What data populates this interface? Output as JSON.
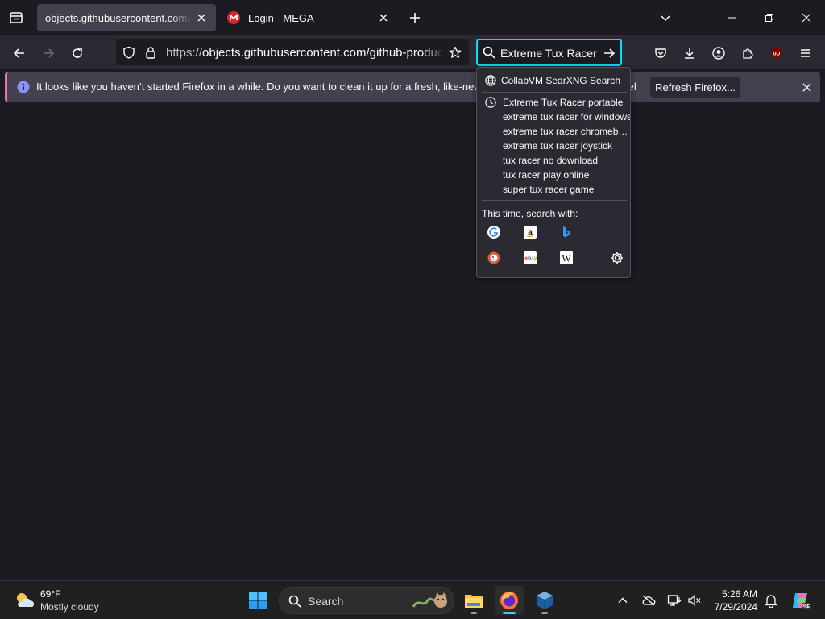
{
  "tabs": [
    {
      "title": "objects.githubusercontent.com/github-production-release-asset",
      "active": true
    },
    {
      "title": "Login - MEGA",
      "active": false
    }
  ],
  "address_bar": {
    "protocol": "https://",
    "url": "objects.githubusercontent.com/github-production-release-asset"
  },
  "search_bar": {
    "value": "Extreme Tux Racer portable"
  },
  "notification": {
    "message": "It looks like you haven’t started Firefox in a while. Do you want to clean it up for a fresh, like-new experience? And by the way, welcome back!",
    "button": "Refresh Firefox..."
  },
  "search_popup": {
    "engine_label": "CollabVM SearXNG Search",
    "suggestions": [
      "Extreme Tux Racer portable",
      "extreme tux racer for windows",
      "extreme tux racer chromebook",
      "extreme tux racer joystick",
      "tux racer no download",
      "tux racer play online",
      "super tux racer game"
    ],
    "this_time_label": "This time, search with:",
    "engines": [
      "google-icon",
      "amazon-icon",
      "bing-icon",
      "duckduckgo-icon",
      "ebay-icon",
      "wikipedia-icon"
    ]
  },
  "taskbar": {
    "temperature": "69°F",
    "condition": "Mostly cloudy",
    "search_label": "Search",
    "time": "5:26 AM",
    "date": "7/29/2024"
  },
  "colors": {
    "accent": "#00ddff",
    "notification_stripe": "#e675b3",
    "info_icon": "#8f8ff8"
  }
}
